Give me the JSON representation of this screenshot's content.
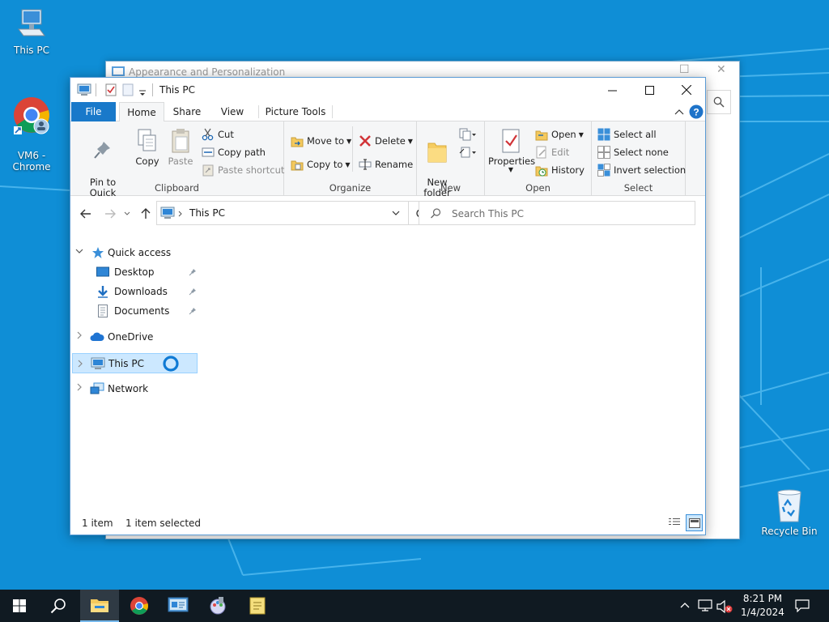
{
  "desktop": {
    "icons": [
      {
        "label": "This PC",
        "icon": "this-pc-icon"
      },
      {
        "label": "VM6 -\nChrome",
        "icon": "chrome-shortcut-icon"
      },
      {
        "label": "Recycle Bin",
        "icon": "recycle-bin-icon"
      }
    ]
  },
  "back_window": {
    "title": "Appearance and Personalization"
  },
  "window": {
    "title": "This PC",
    "tabs": {
      "file": "File",
      "home": "Home",
      "share": "Share",
      "view": "View",
      "picture_tools": "Picture Tools"
    },
    "ribbon": {
      "clipboard": {
        "pin": "Pin to Quick\naccess",
        "copy": "Copy",
        "paste": "Paste",
        "cut": "Cut",
        "copy_path": "Copy path",
        "paste_shortcut": "Paste shortcut",
        "label": "Clipboard"
      },
      "organize": {
        "move_to": "Move to",
        "copy_to": "Copy to",
        "delete": "Delete",
        "rename": "Rename",
        "label": "Organize"
      },
      "new": {
        "new_folder": "New\nfolder",
        "label": "New"
      },
      "open": {
        "properties": "Properties",
        "open": "Open",
        "edit": "Edit",
        "history": "History",
        "label": "Open"
      },
      "select": {
        "select_all": "Select all",
        "select_none": "Select none",
        "invert": "Invert selection",
        "label": "Select"
      }
    },
    "address": {
      "path": "This PC"
    },
    "search": {
      "placeholder": "Search This PC"
    },
    "nav": {
      "quick_access": "Quick access",
      "desktop": "Desktop",
      "downloads": "Downloads",
      "documents": "Documents",
      "onedrive": "OneDrive",
      "this_pc": "This PC",
      "network": "Network"
    },
    "status": {
      "items": "1 item",
      "selected": "1 item selected"
    }
  },
  "taskbar": {
    "time": "8:21 PM",
    "date": "1/4/2024"
  },
  "colors": {
    "desktop": "#0f8ed6",
    "accent": "#1979ca",
    "selection": "#cce8ff",
    "taskbar": "#101a22"
  }
}
